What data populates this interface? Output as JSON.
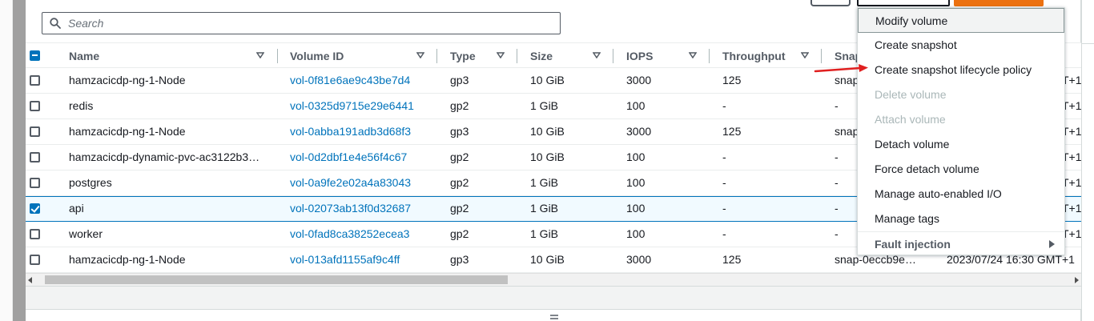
{
  "search": {
    "placeholder": "Search"
  },
  "columns": [
    {
      "label": "Name"
    },
    {
      "label": "Volume ID"
    },
    {
      "label": "Type"
    },
    {
      "label": "Size"
    },
    {
      "label": "IOPS"
    },
    {
      "label": "Throughput"
    },
    {
      "label": "Snap"
    }
  ],
  "rows": [
    {
      "name": "hamzacicdp-ng-1-Node",
      "volume_id": "vol-0f81e6ae9c43be7d4",
      "type": "gp3",
      "size": "10 GiB",
      "iops": "3000",
      "throughput": "125",
      "snapshot": "snap",
      "created": "T+1",
      "checked": false
    },
    {
      "name": "redis",
      "volume_id": "vol-0325d9715e29e6441",
      "type": "gp2",
      "size": "1 GiB",
      "iops": "100",
      "throughput": "-",
      "snapshot": "-",
      "created": "T+1",
      "checked": false
    },
    {
      "name": "hamzacicdp-ng-1-Node",
      "volume_id": "vol-0abba191adb3d68f3",
      "type": "gp3",
      "size": "10 GiB",
      "iops": "3000",
      "throughput": "125",
      "snapshot": "snap",
      "created": "T+1",
      "checked": false
    },
    {
      "name": "hamzacicdp-dynamic-pvc-ac3122b3…",
      "volume_id": "vol-0d2dbf1e4e56f4c67",
      "type": "gp2",
      "size": "10 GiB",
      "iops": "100",
      "throughput": "-",
      "snapshot": "-",
      "created": "T+1",
      "checked": false
    },
    {
      "name": "postgres",
      "volume_id": "vol-0a9fe2e02a4a83043",
      "type": "gp2",
      "size": "1 GiB",
      "iops": "100",
      "throughput": "-",
      "snapshot": "-",
      "created": "T+1",
      "checked": false
    },
    {
      "name": "api",
      "volume_id": "vol-02073ab13f0d32687",
      "type": "gp2",
      "size": "1 GiB",
      "iops": "100",
      "throughput": "-",
      "snapshot": "-",
      "created": "T+1",
      "checked": true
    },
    {
      "name": "worker",
      "volume_id": "vol-0fad8ca38252ecea3",
      "type": "gp2",
      "size": "1 GiB",
      "iops": "100",
      "throughput": "-",
      "snapshot": "-",
      "created": "T+1",
      "checked": false
    },
    {
      "name": "hamzacicdp-ng-1-Node",
      "volume_id": "vol-013afd1155af9c4ff",
      "type": "gp3",
      "size": "10 GiB",
      "iops": "3000",
      "throughput": "125",
      "snapshot": "snap-0eccb9e…",
      "created": "2023/07/24 16:30 GMT+1",
      "checked": false
    }
  ],
  "actions_menu": {
    "items": [
      {
        "label": "Modify volume",
        "state": "hover"
      },
      {
        "label": "Create snapshot",
        "state": "enabled"
      },
      {
        "label": "Create snapshot lifecycle policy",
        "state": "enabled"
      },
      {
        "label": "Delete volume",
        "state": "disabled"
      },
      {
        "label": "Attach volume",
        "state": "disabled"
      },
      {
        "label": "Detach volume",
        "state": "enabled"
      },
      {
        "label": "Force detach volume",
        "state": "enabled"
      },
      {
        "label": "Manage auto-enabled I/O",
        "state": "enabled"
      },
      {
        "label": "Manage tags",
        "state": "enabled"
      },
      {
        "label": "Fault injection",
        "state": "group"
      }
    ]
  },
  "colors": {
    "link": "#0073bb",
    "checkbox_checked": "#0073bb",
    "primary_button": "#ec7211",
    "annotation_arrow": "#e02020",
    "disabled_text": "#aab7b8"
  }
}
